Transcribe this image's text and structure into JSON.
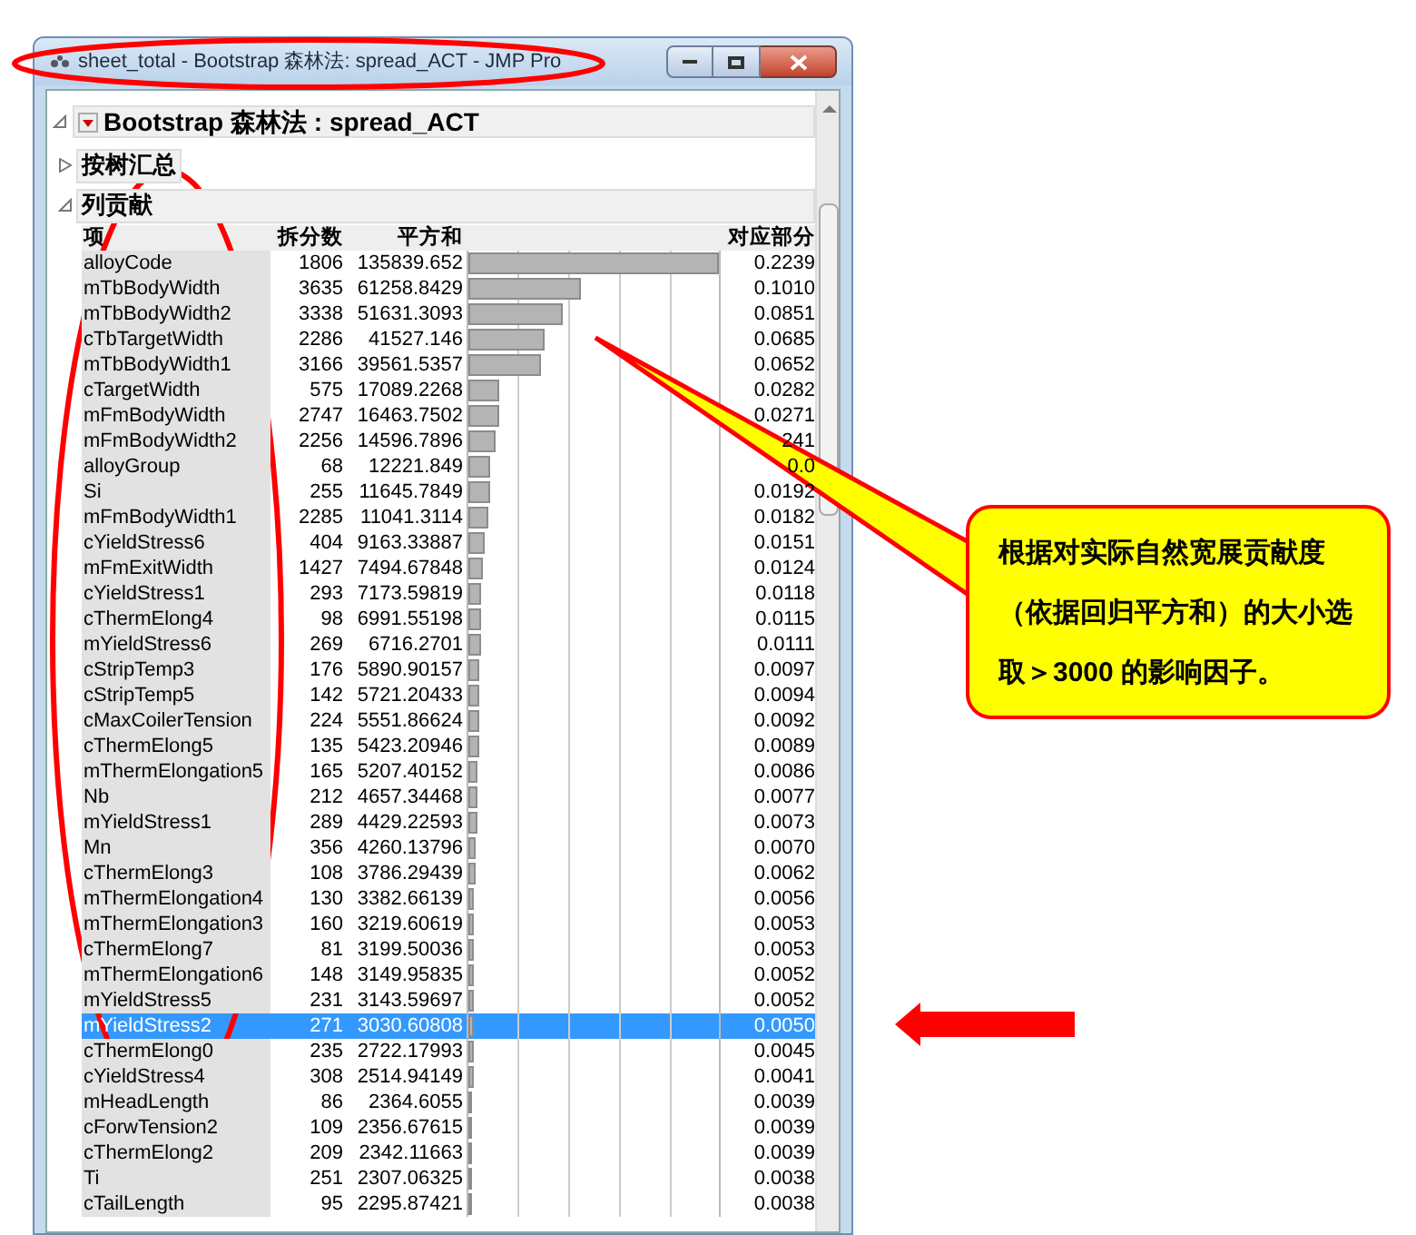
{
  "window": {
    "title": "sheet_total - Bootstrap 森林法: spread_ACT - JMP Pro"
  },
  "report": {
    "title": "Bootstrap 森林法 : spread_ACT",
    "expanded": true,
    "sections": [
      {
        "title": "按树汇总",
        "expanded": false
      },
      {
        "title": "列贡献",
        "expanded": true
      }
    ]
  },
  "table": {
    "columns": [
      "项",
      "拆分数",
      "平方和",
      "对应部分"
    ],
    "rows": [
      {
        "term": "alloyCode",
        "splits": "1806",
        "ss": "135839.652",
        "portion": "0.2239",
        "level": 1,
        "selected": false
      },
      {
        "term": "mTbBodyWidth",
        "splits": "3635",
        "ss": "61258.8429",
        "portion": "0.1010",
        "level": 0.451,
        "selected": false
      },
      {
        "term": "mTbBodyWidth2",
        "splits": "3338",
        "ss": "51631.3093",
        "portion": "0.0851",
        "level": 0.38,
        "selected": false
      },
      {
        "term": "cTbTargetWidth",
        "splits": "2286",
        "ss": "41527.146",
        "portion": "0.0685",
        "level": 0.306,
        "selected": false
      },
      {
        "term": "mTbBodyWidth1",
        "splits": "3166",
        "ss": "39561.5357",
        "portion": "0.0652",
        "level": 0.291,
        "selected": false
      },
      {
        "term": "cTargetWidth",
        "splits": "575",
        "ss": "17089.2268",
        "portion": "0.0282",
        "level": 0.126,
        "selected": false
      },
      {
        "term": "mFmBodyWidth",
        "splits": "2747",
        "ss": "16463.7502",
        "portion": "0.0271",
        "level": 0.121,
        "selected": false
      },
      {
        "term": "mFmBodyWidth2",
        "splits": "2256",
        "ss": "14596.7896",
        "portion": "241",
        "level": 0.107,
        "selected": false
      },
      {
        "term": "alloyGroup",
        "splits": "68",
        "ss": "12221.849",
        "portion": "0.0",
        "level": 0.09,
        "selected": false
      },
      {
        "term": "Si",
        "splits": "255",
        "ss": "11645.7849",
        "portion": "0.0192",
        "level": 0.086,
        "selected": false
      },
      {
        "term": "mFmBodyWidth1",
        "splits": "2285",
        "ss": "11041.3114",
        "portion": "0.0182",
        "level": 0.081,
        "selected": false
      },
      {
        "term": "cYieldStress6",
        "splits": "404",
        "ss": "9163.33887",
        "portion": "0.0151",
        "level": 0.067,
        "selected": false
      },
      {
        "term": "mFmExitWidth",
        "splits": "1427",
        "ss": "7494.67848",
        "portion": "0.0124",
        "level": 0.055,
        "selected": false
      },
      {
        "term": "cYieldStress1",
        "splits": "293",
        "ss": "7173.59819",
        "portion": "0.0118",
        "level": 0.053,
        "selected": false
      },
      {
        "term": "cThermElong4",
        "splits": "98",
        "ss": "6991.55198",
        "portion": "0.0115",
        "level": 0.051,
        "selected": false
      },
      {
        "term": "mYieldStress6",
        "splits": "269",
        "ss": "6716.2701",
        "portion": "0.0111",
        "level": 0.049,
        "selected": false
      },
      {
        "term": "cStripTemp3",
        "splits": "176",
        "ss": "5890.90157",
        "portion": "0.0097",
        "level": 0.043,
        "selected": false
      },
      {
        "term": "cStripTemp5",
        "splits": "142",
        "ss": "5721.20433",
        "portion": "0.0094",
        "level": 0.042,
        "selected": false
      },
      {
        "term": "cMaxCoilerTension",
        "splits": "224",
        "ss": "5551.86624",
        "portion": "0.0092",
        "level": 0.041,
        "selected": false
      },
      {
        "term": "cThermElong5",
        "splits": "135",
        "ss": "5423.20946",
        "portion": "0.0089",
        "level": 0.04,
        "selected": false
      },
      {
        "term": "mThermElongation5",
        "splits": "165",
        "ss": "5207.40152",
        "portion": "0.0086",
        "level": 0.038,
        "selected": false
      },
      {
        "term": "Nb",
        "splits": "212",
        "ss": "4657.34468",
        "portion": "0.0077",
        "level": 0.034,
        "selected": false
      },
      {
        "term": "mYieldStress1",
        "splits": "289",
        "ss": "4429.22593",
        "portion": "0.0073",
        "level": 0.033,
        "selected": false
      },
      {
        "term": "Mn",
        "splits": "356",
        "ss": "4260.13796",
        "portion": "0.0070",
        "level": 0.031,
        "selected": false
      },
      {
        "term": "cThermElong3",
        "splits": "108",
        "ss": "3786.29439",
        "portion": "0.0062",
        "level": 0.028,
        "selected": false
      },
      {
        "term": "mThermElongation4",
        "splits": "130",
        "ss": "3382.66139",
        "portion": "0.0056",
        "level": 0.025,
        "selected": false
      },
      {
        "term": "mThermElongation3",
        "splits": "160",
        "ss": "3219.60619",
        "portion": "0.0053",
        "level": 0.024,
        "selected": false
      },
      {
        "term": "cThermElong7",
        "splits": "81",
        "ss": "3199.50036",
        "portion": "0.0053",
        "level": 0.024,
        "selected": false
      },
      {
        "term": "mThermElongation6",
        "splits": "148",
        "ss": "3149.95835",
        "portion": "0.0052",
        "level": 0.023,
        "selected": false
      },
      {
        "term": "mYieldStress5",
        "splits": "231",
        "ss": "3143.59697",
        "portion": "0.0052",
        "level": 0.023,
        "selected": false
      },
      {
        "term": "mYieldStress2",
        "splits": "271",
        "ss": "3030.60808",
        "portion": "0.0050",
        "level": 0.022,
        "selected": true
      },
      {
        "term": "cThermElong0",
        "splits": "235",
        "ss": "2722.17993",
        "portion": "0.0045",
        "level": 0.02,
        "selected": false
      },
      {
        "term": "cYieldStress4",
        "splits": "308",
        "ss": "2514.94149",
        "portion": "0.0041",
        "level": 0.019,
        "selected": false
      },
      {
        "term": "mHeadLength",
        "splits": "86",
        "ss": "2364.6055",
        "portion": "0.0039",
        "level": 0.017,
        "selected": false
      },
      {
        "term": "cForwTension2",
        "splits": "109",
        "ss": "2356.67615",
        "portion": "0.0039",
        "level": 0.017,
        "selected": false
      },
      {
        "term": "cThermElong2",
        "splits": "209",
        "ss": "2342.11663",
        "portion": "0.0039",
        "level": 0.017,
        "selected": false
      },
      {
        "term": "Ti",
        "splits": "251",
        "ss": "2307.06325",
        "portion": "0.0038",
        "level": 0.017,
        "selected": false
      },
      {
        "term": "cTailLength",
        "splits": "95",
        "ss": "2295.87421",
        "portion": "0.0038",
        "level": 0.017,
        "selected": false
      }
    ]
  },
  "callout": {
    "text": "根据对实际自然宽展贡献度（依据回归平方和）的大小选取＞3000 的影响因子。"
  }
}
